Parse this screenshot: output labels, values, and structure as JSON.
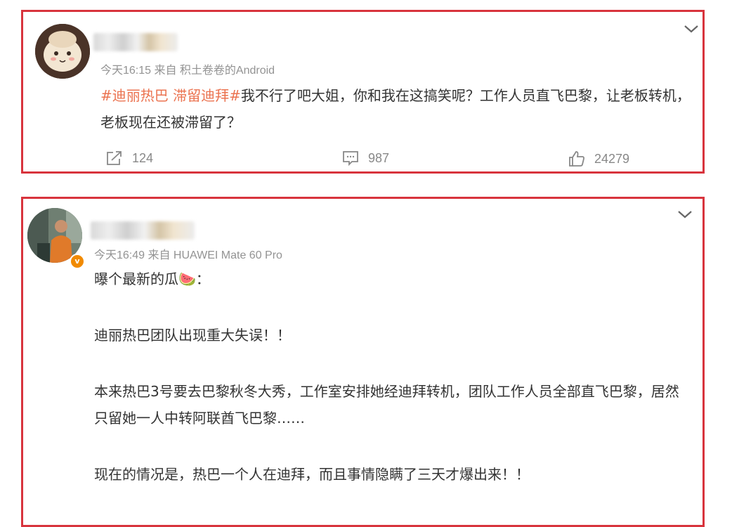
{
  "posts": [
    {
      "meta": "今天16:15  来自 积土卷卷的Android",
      "hashtag": "#迪丽热巴 滞留迪拜#",
      "text": "我不行了吧大姐，你和我在这搞笑呢？工作人员直飞巴黎，让老板转机，老板现在还被滞留了？",
      "actions": {
        "repost": {
          "icon": "share-icon",
          "count": "124"
        },
        "comment": {
          "icon": "comment-icon",
          "count": "987"
        },
        "like": {
          "icon": "like-icon",
          "count": "24279"
        }
      }
    },
    {
      "meta": "今天16:49  来自 HUAWEI Mate 60 Pro",
      "verified_badge": "v",
      "paragraphs": [
        "曝个最新的瓜🍉：",
        "迪丽热巴团队出现重大失误！！",
        "本来热巴3号要去巴黎秋冬大秀，工作室安排她经迪拜转机，团队工作人员全部直飞巴黎，居然只留她一人中转阿联酋飞巴黎……",
        "现在的情况是，热巴一个人在迪拜，而且事情隐瞒了三天才爆出来！！"
      ]
    }
  ],
  "colors": {
    "border": "#d8343d",
    "hashtag": "#eb7350",
    "meta": "#939393",
    "text": "#333333"
  }
}
